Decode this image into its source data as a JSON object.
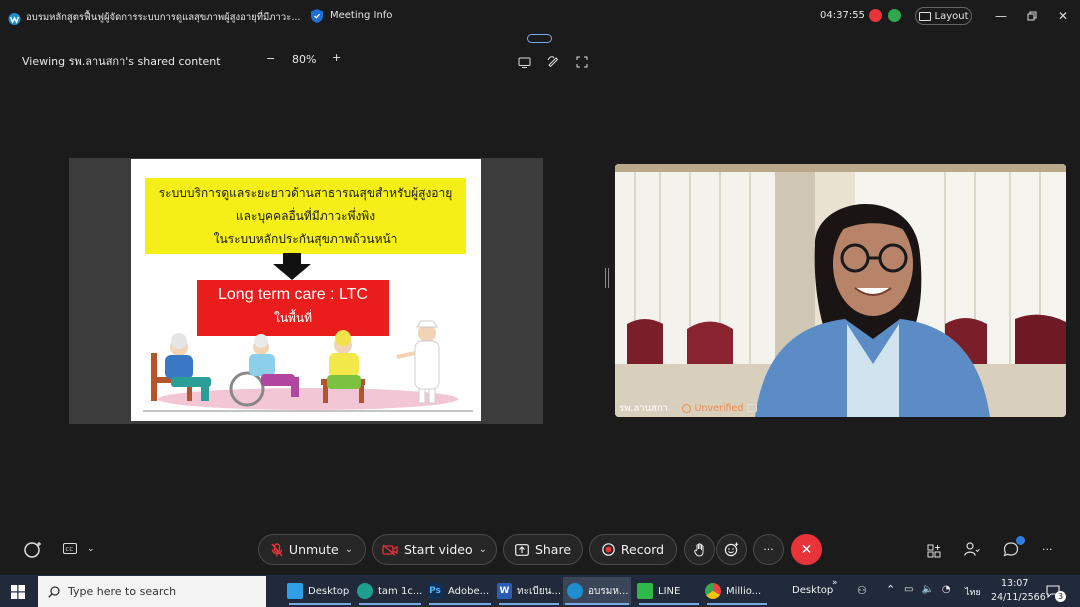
{
  "titlebar": {
    "meeting_title": "อบรมหลักสูตรฟื้นฟูผู้จัดการระบบการดูแลสุขภาพผู้สูงอายุที่มีภาวะ...",
    "meeting_info": "Meeting Info",
    "clock": "04:37:55",
    "layout": "Layout"
  },
  "share": {
    "viewing": "Viewing รพ.ลานสกา's shared content",
    "zoom": "80%",
    "minus": "−",
    "plus": "+"
  },
  "slide": {
    "line1": "ระบบบริการดูแลระยะยาวด้านสาธารณสุขสำหรับผู้สูงอายุ",
    "line2": "และบุคคลอื่นที่มีภาวะพึ่งพิง",
    "line3": "ในระบบหลักประกันสุขภาพถ้วนหน้า",
    "ltc_title": "Long term care : LTC",
    "ltc_sub": "ในพื้นที่"
  },
  "video": {
    "participant_name": "รพ.ลานสกา",
    "status": "Unverified"
  },
  "controls": {
    "unmute": "Unmute",
    "start_video": "Start video",
    "share": "Share",
    "record": "Record",
    "more": "···"
  },
  "taskbar": {
    "search_placeholder": "Type here to search",
    "items": [
      "Desktop",
      "tam 1c...",
      "Adobe...",
      "ทะเบียน...",
      "อบรมห...",
      "LINE",
      "Millio..."
    ],
    "desktop_label": "Desktop",
    "lang": "ไทย",
    "time": "13:07",
    "date": "24/11/2566",
    "notif_count": "3"
  },
  "colors": {
    "accent_blue": "#2f7de1",
    "end_red": "#e8333a",
    "slide_yellow": "#f6ee17",
    "slide_red": "#ea1c1c"
  }
}
